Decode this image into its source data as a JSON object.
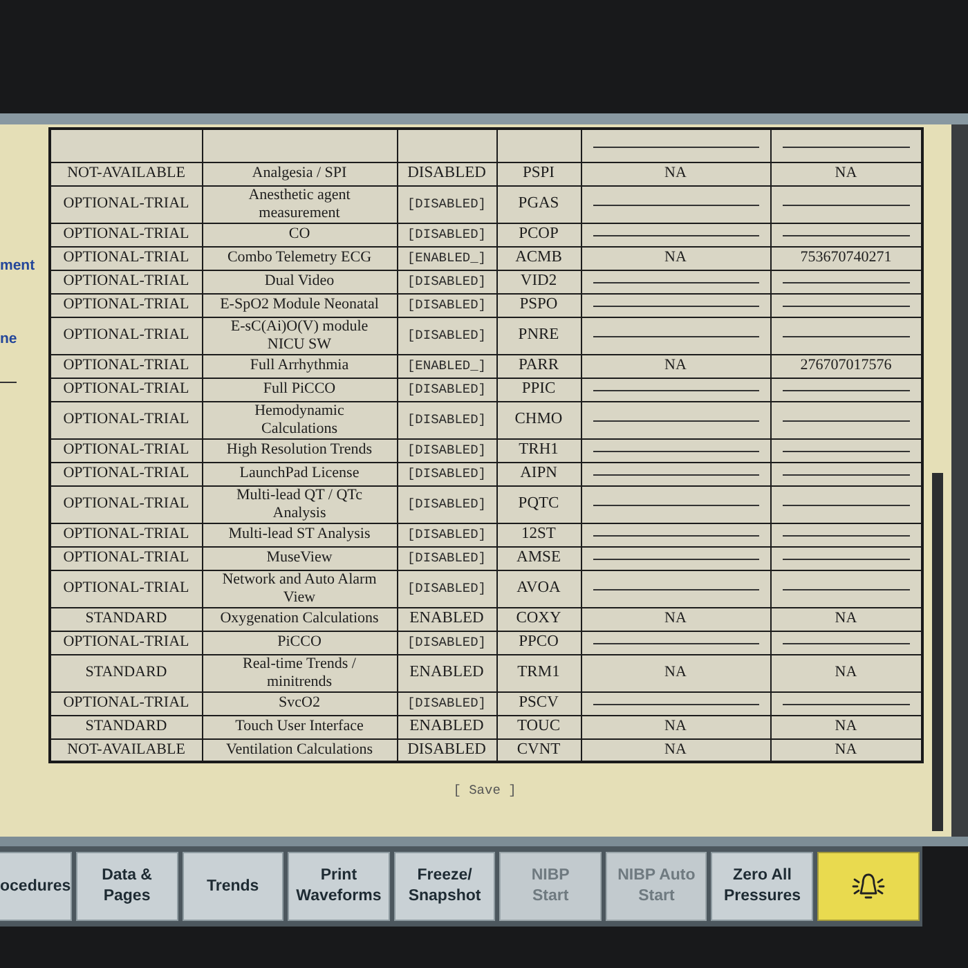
{
  "sidebar": {
    "items": [
      {
        "label": "ment"
      },
      {
        "label": "ne"
      }
    ]
  },
  "table": {
    "rows": [
      {
        "column_1": "NOT-AVAILABLE",
        "column_2": "Analgesia / SPI",
        "column_3": {
          "text": "DISABLED",
          "kind": "fixed"
        },
        "column_4": "PSPI",
        "column_5": "NA",
        "column_6": "NA"
      },
      {
        "column_1": "OPTIONAL-TRIAL",
        "column_2": "Anesthetic agent\nmeasurement",
        "column_3": {
          "text": "[DISABLED]",
          "kind": "option"
        },
        "column_4": "PGAS"
      },
      {
        "column_1": "OPTIONAL-TRIAL",
        "column_2": "CO",
        "column_3": {
          "text": "[DISABLED]",
          "kind": "option"
        },
        "column_4": "PCOP"
      },
      {
        "column_1": "OPTIONAL-TRIAL",
        "column_2": "Combo Telemetry ECG",
        "column_3": {
          "text": "[ENABLED_]",
          "kind": "option"
        },
        "column_4": "ACMB",
        "column_5": "NA",
        "column_6": "753670740271"
      },
      {
        "column_1": "OPTIONAL-TRIAL",
        "column_2": "Dual Video",
        "column_3": {
          "text": "[DISABLED]",
          "kind": "option"
        },
        "column_4": "VID2"
      },
      {
        "column_1": "OPTIONAL-TRIAL",
        "column_2": "E-SpO2 Module Neonatal",
        "column_3": {
          "text": "[DISABLED]",
          "kind": "option"
        },
        "column_4": "PSPO"
      },
      {
        "column_1": "OPTIONAL-TRIAL",
        "column_2": "E-sC(Ai)O(V) module\nNICU SW",
        "column_3": {
          "text": "[DISABLED]",
          "kind": "option"
        },
        "column_4": "PNRE"
      },
      {
        "column_1": "OPTIONAL-TRIAL",
        "column_2": "Full Arrhythmia",
        "column_3": {
          "text": "[ENABLED_]",
          "kind": "option"
        },
        "column_4": "PARR",
        "column_5": "NA",
        "column_6": "276707017576"
      },
      {
        "column_1": "OPTIONAL-TRIAL",
        "column_2": "Full PiCCO",
        "column_3": {
          "text": "[DISABLED]",
          "kind": "option"
        },
        "column_4": "PPIC"
      },
      {
        "column_1": "OPTIONAL-TRIAL",
        "column_2": "Hemodynamic\nCalculations",
        "column_3": {
          "text": "[DISABLED]",
          "kind": "option"
        },
        "column_4": "CHMO"
      },
      {
        "column_1": "OPTIONAL-TRIAL",
        "column_2": "High Resolution Trends",
        "column_3": {
          "text": "[DISABLED]",
          "kind": "option"
        },
        "column_4": "TRH1"
      },
      {
        "column_1": "OPTIONAL-TRIAL",
        "column_2": "LaunchPad License",
        "column_3": {
          "text": "[DISABLED]",
          "kind": "option"
        },
        "column_4": "AIPN"
      },
      {
        "column_1": "OPTIONAL-TRIAL",
        "column_2": "Multi-lead QT / QTc\nAnalysis",
        "column_3": {
          "text": "[DISABLED]",
          "kind": "option"
        },
        "column_4": "PQTC"
      },
      {
        "column_1": "OPTIONAL-TRIAL",
        "column_2": "Multi-lead ST Analysis",
        "column_3": {
          "text": "[DISABLED]",
          "kind": "option"
        },
        "column_4": "12ST"
      },
      {
        "column_1": "OPTIONAL-TRIAL",
        "column_2": "MuseView",
        "column_3": {
          "text": "[DISABLED]",
          "kind": "option"
        },
        "column_4": "AMSE"
      },
      {
        "column_1": "OPTIONAL-TRIAL",
        "column_2": "Network and Auto Alarm\nView",
        "column_3": {
          "text": "[DISABLED]",
          "kind": "option"
        },
        "column_4": "AVOA"
      },
      {
        "column_1": "STANDARD",
        "column_2": "Oxygenation Calculations",
        "column_3": {
          "text": "ENABLED",
          "kind": "fixed"
        },
        "column_4": "COXY",
        "column_5": "NA",
        "column_6": "NA"
      },
      {
        "column_1": "OPTIONAL-TRIAL",
        "column_2": "PiCCO",
        "column_3": {
          "text": "[DISABLED]",
          "kind": "option"
        },
        "column_4": "PPCO"
      },
      {
        "column_1": "STANDARD",
        "column_2": "Real-time Trends /\nminitrends",
        "column_3": {
          "text": "ENABLED",
          "kind": "fixed"
        },
        "column_4": "TRM1",
        "column_5": "NA",
        "column_6": "NA"
      },
      {
        "column_1": "OPTIONAL-TRIAL",
        "column_2": "SvcO2",
        "column_3": {
          "text": "[DISABLED]",
          "kind": "option"
        },
        "column_4": "PSCV"
      },
      {
        "column_1": "STANDARD",
        "column_2": "Touch User Interface",
        "column_3": {
          "text": "ENABLED",
          "kind": "fixed"
        },
        "column_4": "TOUC",
        "column_5": "NA",
        "column_6": "NA"
      },
      {
        "column_1": "NOT-AVAILABLE",
        "column_2": "Ventilation Calculations",
        "column_3": {
          "text": "DISABLED",
          "kind": "fixed"
        },
        "column_4": "CVNT",
        "column_5": "NA",
        "column_6": "NA"
      }
    ]
  },
  "save_button": {
    "label": "[ Save ]"
  },
  "buttons": [
    {
      "kind": "text",
      "label": "ocedures",
      "disabled": false
    },
    {
      "kind": "text",
      "label": "Data &\nPages",
      "disabled": false
    },
    {
      "kind": "text",
      "label": "Trends",
      "disabled": false
    },
    {
      "kind": "text",
      "label": "Print\nWaveforms",
      "disabled": false
    },
    {
      "kind": "text",
      "label": "Freeze/\nSnapshot",
      "disabled": false
    },
    {
      "kind": "text",
      "label": "NIBP\nStart",
      "disabled": true
    },
    {
      "kind": "text",
      "label": "NIBP Auto\nStart",
      "disabled": true
    },
    {
      "kind": "text",
      "label": "Zero All\nPressures",
      "disabled": false
    },
    {
      "kind": "alarm",
      "disabled": false
    }
  ]
}
